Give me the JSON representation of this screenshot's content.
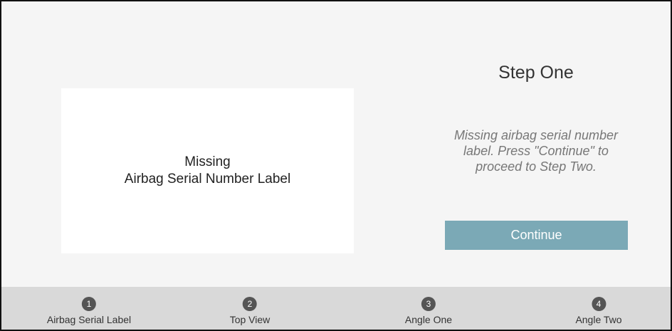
{
  "image_placeholder": {
    "line1": "Missing",
    "line2": "Airbag Serial Number Label"
  },
  "step_panel": {
    "title": "Step One",
    "description": "Missing airbag serial number label. Press \"Continue\" to proceed to Step Two.",
    "continue_label": "Continue",
    "button_color": "#7ba9b6"
  },
  "stepper": {
    "steps": [
      {
        "number": "1",
        "label": "Airbag Serial Label"
      },
      {
        "number": "2",
        "label": "Top View"
      },
      {
        "number": "3",
        "label": "Angle One"
      },
      {
        "number": "4",
        "label": "Angle Two"
      }
    ]
  }
}
